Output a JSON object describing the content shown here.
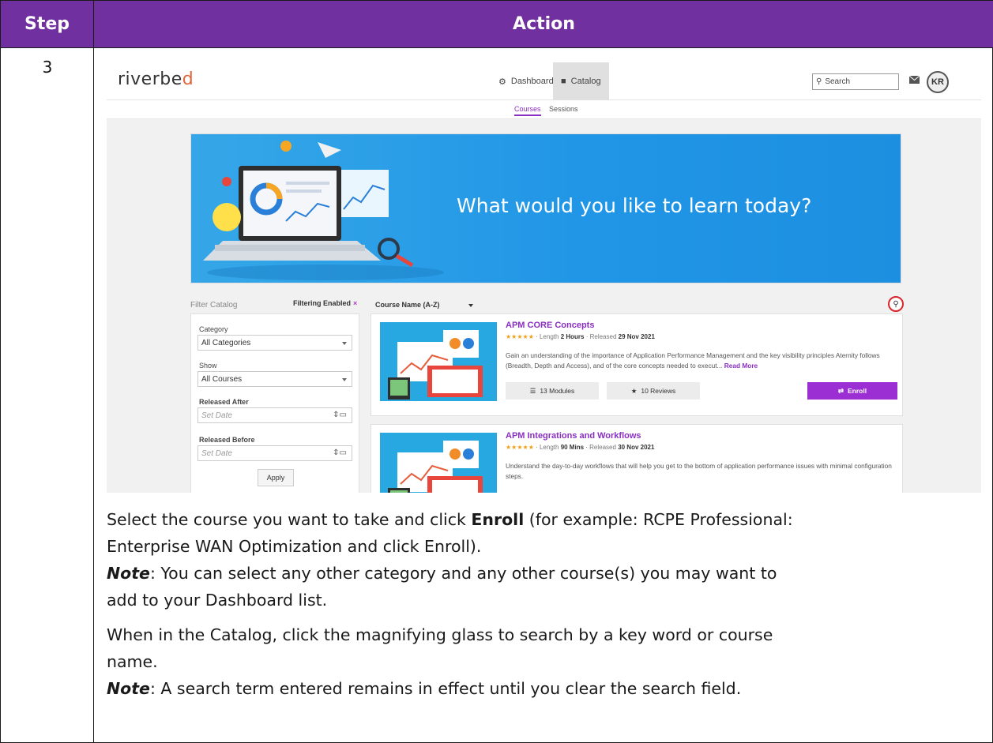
{
  "table": {
    "header_step": "Step",
    "header_action": "Action",
    "step_number": "3"
  },
  "app": {
    "logo": "riverbed",
    "nav": {
      "dashboard": "Dashboard",
      "catalog": "Catalog"
    },
    "search_placeholder": "Search",
    "avatar_initials": "KR",
    "subnav": {
      "courses": "Courses",
      "sessions": "Sessions"
    },
    "banner_text": "What would you like to learn today?"
  },
  "filter": {
    "title": "Filter Catalog",
    "filtering_enabled": "Filtering Enabled",
    "filtering_clear": "×",
    "category_label": "Category",
    "category_value": "All Categories",
    "show_label": "Show",
    "show_value": "All Courses",
    "released_after_label": "Released After",
    "released_after_placeholder": "Set Date",
    "released_before_label": "Released Before",
    "released_before_placeholder": "Set Date",
    "apply": "Apply"
  },
  "sort": {
    "value": "Course Name (A-Z)"
  },
  "courses": [
    {
      "title": "APM CORE Concepts",
      "stars": "★★★★★",
      "length_label": "· Length",
      "length_value": "2 Hours",
      "released_label": "· Released",
      "released_value": "29 Nov 2021",
      "description": "Gain an understanding of the importance of Application Performance Management and the key visibility principles Aternity follows (Breadth, Depth and Access), and of the core concepts needed to execut...",
      "read_more": "Read More",
      "modules": "13 Modules",
      "reviews": "10 Reviews",
      "enroll": "Enroll"
    },
    {
      "title": "APM Integrations and Workflows",
      "stars": "★★★★★",
      "length_label": "· Length",
      "length_value": "90 Mins",
      "released_label": "· Released",
      "released_value": "30 Nov 2021",
      "description": "Understand the day-to-day workflows that will help you get to the bottom of application performance issues with minimal configuration steps."
    }
  ],
  "instructions": {
    "line1_a": "Select the course you want to take and click ",
    "line1_bold": "Enroll",
    "line1_b": " (for example: RCPE Professional:",
    "line2": "Enterprise WAN Optimization and click Enroll).",
    "note_label": "Note",
    "line3": ": You can select any other category and any other course(s) you may want to",
    "line4": "add to your Dashboard list.",
    "line5": "When in the Catalog, click the magnifying glass to search by a key word or course",
    "line6": "name.",
    "line7": ": A search term entered remains in effect until you clear the search field."
  }
}
